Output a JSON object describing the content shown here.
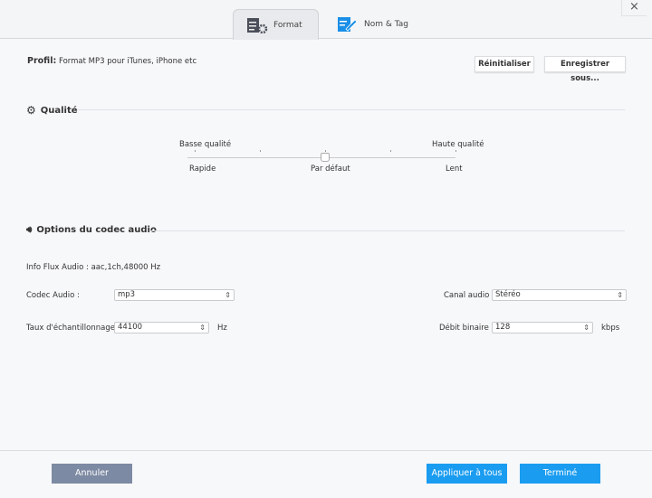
{
  "tabs": [
    {
      "label": "Format",
      "icon": "format-settings-icon",
      "active": true
    },
    {
      "label": "Nom & Tag",
      "icon": "edit-tag-icon",
      "active": false
    }
  ],
  "close_icon": "×",
  "profile": {
    "label": "Profil:",
    "value": "Format MP3 pour iTunes, iPhone etc",
    "reset": "Réinitialiser",
    "save_as": "Enregistrer sous..."
  },
  "quality": {
    "title": "Qualité",
    "icon": "gear-icon",
    "low": "Basse qualité",
    "high": "Haute qualité",
    "fast": "Rapide",
    "default": "Par défaut",
    "slow": "Lent",
    "steps": 5,
    "value_index": 2
  },
  "codec": {
    "title": "Options du codec audio",
    "icon": "speaker-icon",
    "info": "Info Flux Audio : aac,1ch,48000 Hz",
    "codec_label": "Codec Audio :",
    "codec_value": "mp3",
    "channel_label": "Canal audio :",
    "channel_value": "Stéréo",
    "rate_label": "Taux d'échantillonnage :",
    "rate_value": "44100",
    "rate_unit": "Hz",
    "bitrate_label": "Débit binaire :",
    "bitrate_value": "128",
    "bitrate_unit": "kbps"
  },
  "footer": {
    "cancel": "Annuler",
    "apply_all": "Appliquer à tous",
    "done": "Terminé"
  },
  "colors": {
    "accent": "#1a9cf0",
    "cancel": "#7d8aa3"
  }
}
